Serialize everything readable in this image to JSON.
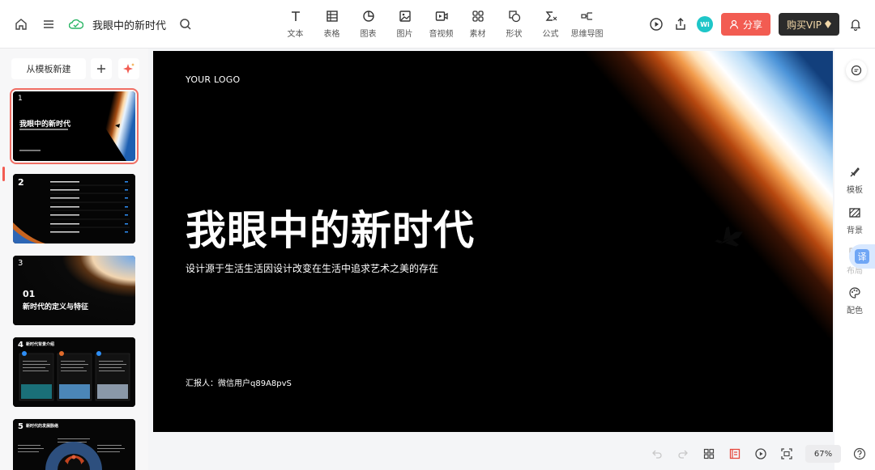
{
  "header": {
    "doc_title": "我眼中的新时代",
    "tools": [
      {
        "label": "文本",
        "icon": "text-icon"
      },
      {
        "label": "表格",
        "icon": "table-icon"
      },
      {
        "label": "图表",
        "icon": "chart-icon"
      },
      {
        "label": "图片",
        "icon": "image-icon"
      },
      {
        "label": "音视频",
        "icon": "media-icon"
      },
      {
        "label": "素材",
        "icon": "material-icon"
      },
      {
        "label": "形状",
        "icon": "shape-icon"
      },
      {
        "label": "公式",
        "icon": "formula-icon"
      },
      {
        "label": "思维导图",
        "icon": "mindmap-icon"
      }
    ],
    "avatar_text": "Wi",
    "share_label": "分享",
    "vip_label": "购买VIP",
    "accent": "#f25c52"
  },
  "left_panel": {
    "new_from_template": "从模板新建",
    "slides": [
      {
        "num": "1",
        "title": "我眼中的新时代"
      },
      {
        "num": "2",
        "title": ""
      },
      {
        "num": "3",
        "title": "01",
        "subtitle": "新时代的定义与特征"
      },
      {
        "num": "4",
        "title": "新时代背景介绍"
      },
      {
        "num": "5",
        "title": "新时代的发展脉络"
      }
    ]
  },
  "slide": {
    "logo": "YOUR LOGO",
    "title": "我眼中的新时代",
    "subtitle": "设计源于生活生活因设计改变在生活中追求艺术之美的存在",
    "reporter": "汇报人：微信用户q89A8pvS"
  },
  "right_rail": {
    "items": [
      {
        "label": "模板",
        "icon": "template-icon"
      },
      {
        "label": "背景",
        "icon": "background-icon"
      },
      {
        "label": "布局",
        "icon": "layout-icon"
      },
      {
        "label": "配色",
        "icon": "palette-icon"
      }
    ],
    "translate_label": "译"
  },
  "bottom_bar": {
    "zoom": "67%"
  }
}
